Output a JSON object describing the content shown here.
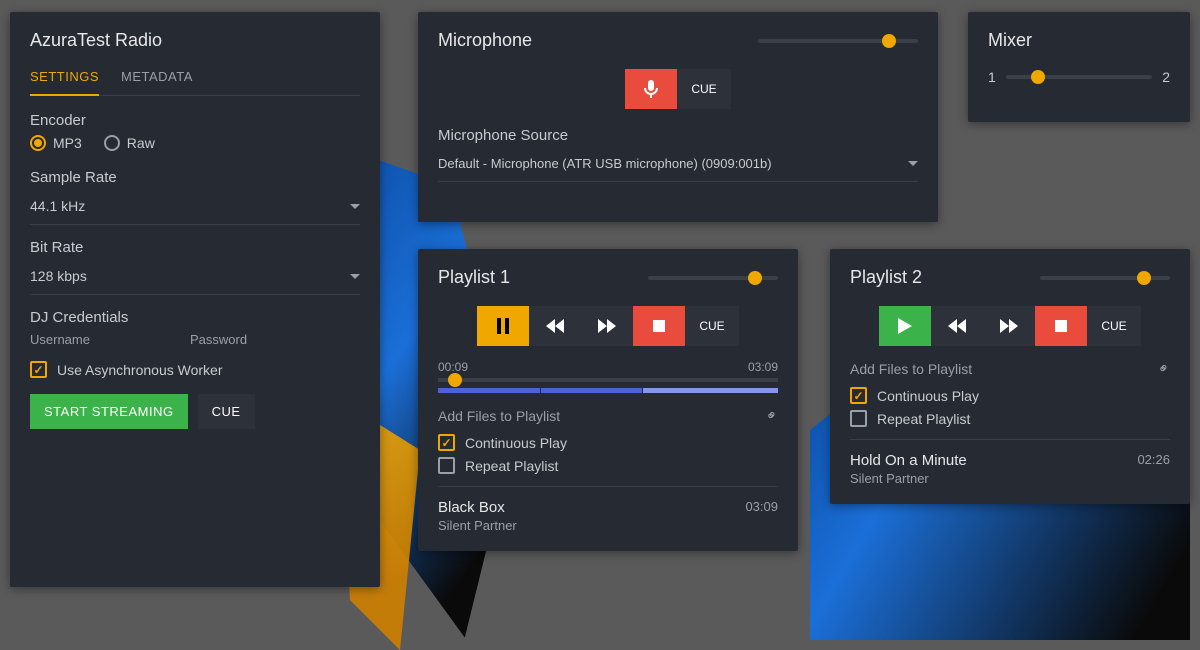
{
  "station": {
    "title": "AzuraTest Radio",
    "tabs": {
      "settings": "SETTINGS",
      "metadata": "METADATA"
    },
    "encoder": {
      "label": "Encoder",
      "opt_mp3": "MP3",
      "opt_raw": "Raw"
    },
    "sample_rate": {
      "label": "Sample Rate",
      "value": "44.1 kHz"
    },
    "bit_rate": {
      "label": "Bit Rate",
      "value": "128 kbps"
    },
    "dj": {
      "label": "DJ Credentials",
      "username": "Username",
      "password": "Password"
    },
    "async_label": "Use Asynchronous Worker",
    "start_btn": "START STREAMING",
    "cue_btn": "CUE"
  },
  "microphone": {
    "title": "Microphone",
    "cue": "CUE",
    "source_label": "Microphone Source",
    "source_value": "Default - Microphone (ATR USB microphone) (0909:001b)",
    "volume_pct": 82
  },
  "mixer": {
    "title": "Mixer",
    "left": "1",
    "right": "2",
    "pos_pct": 22
  },
  "playlist1": {
    "title": "Playlist 1",
    "vol_pct": 82,
    "cue": "CUE",
    "elapsed": "00:09",
    "total": "03:09",
    "seek_pct": 5,
    "add_files": "Add Files to Playlist",
    "cont": "Continuous Play",
    "repeat": "Repeat Playlist",
    "track_name": "Black Box",
    "track_artist": "Silent Partner",
    "track_dur": "03:09"
  },
  "playlist2": {
    "title": "Playlist 2",
    "vol_pct": 80,
    "cue": "CUE",
    "add_files": "Add Files to Playlist",
    "cont": "Continuous Play",
    "repeat": "Repeat Playlist",
    "track_name": "Hold On a Minute",
    "track_artist": "Silent Partner",
    "track_dur": "02:26"
  }
}
